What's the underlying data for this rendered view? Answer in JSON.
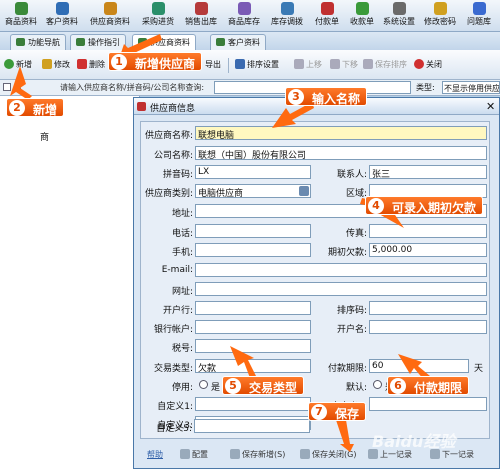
{
  "menu": [
    {
      "label": "商品资料",
      "color": "#3a8a3a"
    },
    {
      "label": "客户资料",
      "color": "#2f6db5"
    },
    {
      "label": "供应商资料",
      "color": "#c9861a"
    },
    {
      "label": "采购进货",
      "color": "#2a8f6a"
    },
    {
      "label": "销售出库",
      "color": "#b53a3a"
    },
    {
      "label": "商品库存",
      "color": "#7a5ab5"
    },
    {
      "label": "库存调拨",
      "color": "#3a7ab5"
    },
    {
      "label": "付款单",
      "color": "#c03030"
    },
    {
      "label": "收款单",
      "color": "#3a9a3a"
    },
    {
      "label": "系统设置",
      "color": "#6a6a6a"
    },
    {
      "label": "修改密码",
      "color": "#d0a020"
    },
    {
      "label": "问题库",
      "color": "#3a6ad0"
    }
  ],
  "tabs": [
    "功能导航",
    "操作指引",
    "供应商资料",
    "客户资料"
  ],
  "toolbar": {
    "new": "新增",
    "edit": "修改",
    "del": "删除",
    "export": "导出",
    "sort": "排序设置",
    "up": "上移",
    "down": "下移",
    "save_sort": "保存排序",
    "close": "关闭"
  },
  "filter": {
    "checkbox": "显",
    "placeholder": "请输入供应商名称/拼音码/公司名称查询:",
    "type_label": "类型:",
    "type_value": "不显示停用供应商"
  },
  "left_pane": {
    "col": "商"
  },
  "dialog": {
    "title": "供应商信息",
    "fields": {
      "supplier_name": {
        "label": "供应商名称:",
        "value": "联想电脑"
      },
      "company": {
        "label": "公司名称:",
        "value": "联想（中国）股份有限公司"
      },
      "pinyin": {
        "label": "拼音码:",
        "value": "LX"
      },
      "contact": {
        "label": "联系人:",
        "value": "张三"
      },
      "category": {
        "label": "供应商类别:",
        "value": "电脑供应商"
      },
      "region": {
        "label": "区域:",
        "value": ""
      },
      "address": {
        "label": "地址:",
        "value": ""
      },
      "phone": {
        "label": "电话:",
        "value": ""
      },
      "fax": {
        "label": "传真:",
        "value": ""
      },
      "mobile": {
        "label": "手机:",
        "value": ""
      },
      "opening_debt": {
        "label": "期初欠款:",
        "value": "5,000.00"
      },
      "email": {
        "label": "E-mail:",
        "value": ""
      },
      "website": {
        "label": "网址:",
        "value": ""
      },
      "bank": {
        "label": "开户行:",
        "value": ""
      },
      "sort_code": {
        "label": "排序码:",
        "value": ""
      },
      "bank_account": {
        "label": "银行帐户:",
        "value": ""
      },
      "account_name": {
        "label": "开户名:",
        "value": ""
      },
      "tax_no": {
        "label": "税号:",
        "value": ""
      },
      "trade_type": {
        "label": "交易类型:",
        "value": "欠款"
      },
      "pay_term": {
        "label": "付款期限:",
        "value": "60",
        "unit": "天"
      },
      "disabled": {
        "label": "停用:",
        "option": "是"
      },
      "default": {
        "label": "默认:",
        "option": "是"
      },
      "custom1": {
        "label": "自定义1:",
        "value": ""
      },
      "custom2": {
        "label": "自定义2:",
        "value": ""
      },
      "custom3": {
        "label": "自定义3:",
        "value": ""
      },
      "custom5": {
        "label": "自定义5:",
        "value": ""
      }
    },
    "buttons": {
      "help": "帮助",
      "config": "配置",
      "save_new": "保存新增(S)",
      "save_close": "保存关闭(G)",
      "prev": "上一记录",
      "next": "下一记录"
    }
  },
  "annotations": [
    {
      "num": "1",
      "text": "新增供应商"
    },
    {
      "num": "2",
      "text": "新增"
    },
    {
      "num": "3",
      "text": "输入名称"
    },
    {
      "num": "4",
      "text": "可录入期初欠款"
    },
    {
      "num": "5",
      "text": "交易类型"
    },
    {
      "num": "6",
      "text": "付款期限"
    },
    {
      "num": "7",
      "text": "保存"
    }
  ],
  "watermark": "Baidu经验",
  "accent": "#ff6a10"
}
